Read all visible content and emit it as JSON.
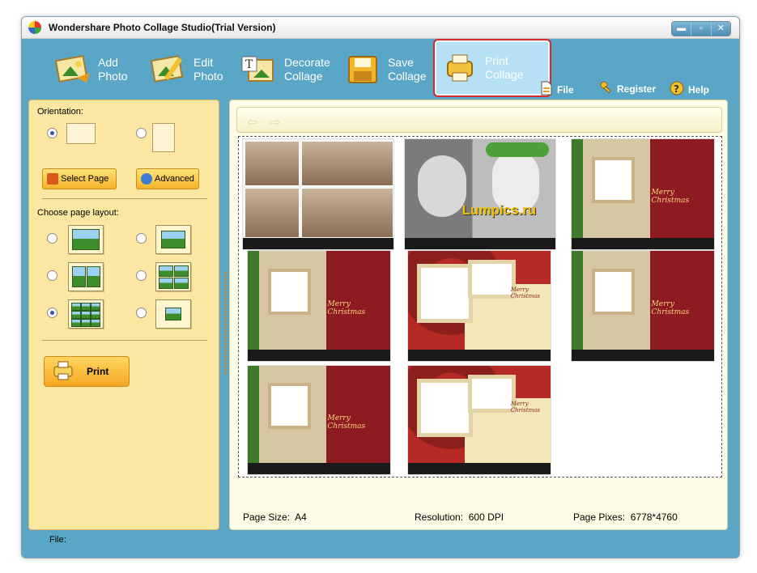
{
  "window": {
    "title": "Wondershare Photo Collage Studio(Trial Version)",
    "controls": {
      "minimize": "▬",
      "maximize": "▫",
      "close": "✕"
    }
  },
  "toolbar": {
    "items": [
      {
        "line1": "Add",
        "line2": "Photo",
        "icon": "add-photo-icon"
      },
      {
        "line1": "Edit",
        "line2": "Photo",
        "icon": "edit-photo-icon"
      },
      {
        "line1": "Decorate",
        "line2": "Collage",
        "icon": "decorate-collage-icon"
      },
      {
        "line1": "Save",
        "line2": "Collage",
        "icon": "save-collage-icon"
      },
      {
        "line1": "Print",
        "line2": "Collage",
        "icon": "print-collage-icon",
        "active": true
      }
    ],
    "file_label": "File",
    "register_label": "Register",
    "help_label": "Help"
  },
  "left_panel": {
    "orientation_label": "Orientation:",
    "orientation_selected": "landscape",
    "select_page_label": "Select Page",
    "advanced_label": "Advanced",
    "layout_label": "Choose page layout:",
    "layout_selected": 5,
    "print_label": "Print"
  },
  "preview": {
    "watermark_text": "Lumpics.ru",
    "card_text": "Merry Christmas"
  },
  "status": {
    "page_size_label": "Page Size:",
    "page_size_value": "A4",
    "resolution_label": "Resolution:",
    "resolution_value": "600 DPI",
    "page_pixes_label": "Page Pixes:",
    "page_pixes_value": "6778*4760",
    "file_label": "File:"
  },
  "colors": {
    "window_bg": "#5aa6c6",
    "panel_yellow": "#fce7a2",
    "active_border": "#d82a2a"
  }
}
